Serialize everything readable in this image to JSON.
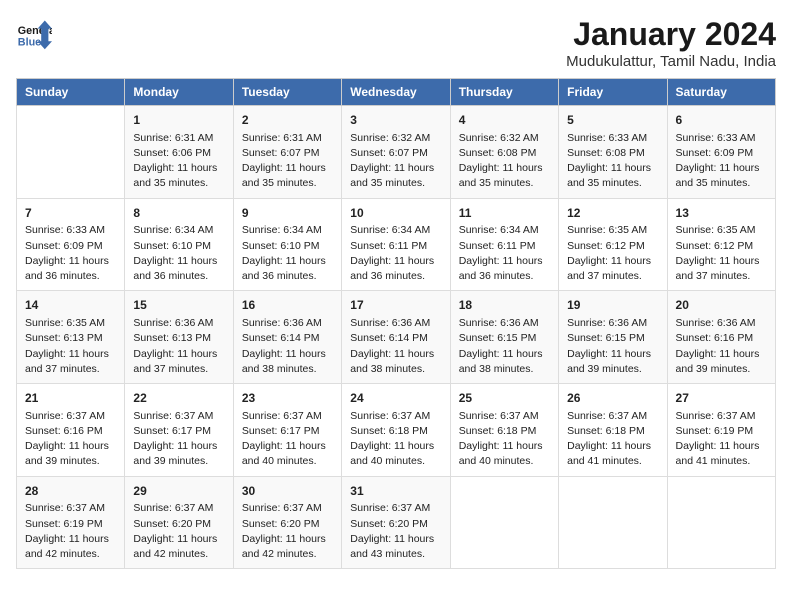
{
  "logo": {
    "line1": "General",
    "line2": "Blue"
  },
  "title": "January 2024",
  "subtitle": "Mudukulattur, Tamil Nadu, India",
  "days_of_week": [
    "Sunday",
    "Monday",
    "Tuesday",
    "Wednesday",
    "Thursday",
    "Friday",
    "Saturday"
  ],
  "weeks": [
    [
      {
        "num": "",
        "info": ""
      },
      {
        "num": "1",
        "info": "Sunrise: 6:31 AM\nSunset: 6:06 PM\nDaylight: 11 hours\nand 35 minutes."
      },
      {
        "num": "2",
        "info": "Sunrise: 6:31 AM\nSunset: 6:07 PM\nDaylight: 11 hours\nand 35 minutes."
      },
      {
        "num": "3",
        "info": "Sunrise: 6:32 AM\nSunset: 6:07 PM\nDaylight: 11 hours\nand 35 minutes."
      },
      {
        "num": "4",
        "info": "Sunrise: 6:32 AM\nSunset: 6:08 PM\nDaylight: 11 hours\nand 35 minutes."
      },
      {
        "num": "5",
        "info": "Sunrise: 6:33 AM\nSunset: 6:08 PM\nDaylight: 11 hours\nand 35 minutes."
      },
      {
        "num": "6",
        "info": "Sunrise: 6:33 AM\nSunset: 6:09 PM\nDaylight: 11 hours\nand 35 minutes."
      }
    ],
    [
      {
        "num": "7",
        "info": "Sunrise: 6:33 AM\nSunset: 6:09 PM\nDaylight: 11 hours\nand 36 minutes."
      },
      {
        "num": "8",
        "info": "Sunrise: 6:34 AM\nSunset: 6:10 PM\nDaylight: 11 hours\nand 36 minutes."
      },
      {
        "num": "9",
        "info": "Sunrise: 6:34 AM\nSunset: 6:10 PM\nDaylight: 11 hours\nand 36 minutes."
      },
      {
        "num": "10",
        "info": "Sunrise: 6:34 AM\nSunset: 6:11 PM\nDaylight: 11 hours\nand 36 minutes."
      },
      {
        "num": "11",
        "info": "Sunrise: 6:34 AM\nSunset: 6:11 PM\nDaylight: 11 hours\nand 36 minutes."
      },
      {
        "num": "12",
        "info": "Sunrise: 6:35 AM\nSunset: 6:12 PM\nDaylight: 11 hours\nand 37 minutes."
      },
      {
        "num": "13",
        "info": "Sunrise: 6:35 AM\nSunset: 6:12 PM\nDaylight: 11 hours\nand 37 minutes."
      }
    ],
    [
      {
        "num": "14",
        "info": "Sunrise: 6:35 AM\nSunset: 6:13 PM\nDaylight: 11 hours\nand 37 minutes."
      },
      {
        "num": "15",
        "info": "Sunrise: 6:36 AM\nSunset: 6:13 PM\nDaylight: 11 hours\nand 37 minutes."
      },
      {
        "num": "16",
        "info": "Sunrise: 6:36 AM\nSunset: 6:14 PM\nDaylight: 11 hours\nand 38 minutes."
      },
      {
        "num": "17",
        "info": "Sunrise: 6:36 AM\nSunset: 6:14 PM\nDaylight: 11 hours\nand 38 minutes."
      },
      {
        "num": "18",
        "info": "Sunrise: 6:36 AM\nSunset: 6:15 PM\nDaylight: 11 hours\nand 38 minutes."
      },
      {
        "num": "19",
        "info": "Sunrise: 6:36 AM\nSunset: 6:15 PM\nDaylight: 11 hours\nand 39 minutes."
      },
      {
        "num": "20",
        "info": "Sunrise: 6:36 AM\nSunset: 6:16 PM\nDaylight: 11 hours\nand 39 minutes."
      }
    ],
    [
      {
        "num": "21",
        "info": "Sunrise: 6:37 AM\nSunset: 6:16 PM\nDaylight: 11 hours\nand 39 minutes."
      },
      {
        "num": "22",
        "info": "Sunrise: 6:37 AM\nSunset: 6:17 PM\nDaylight: 11 hours\nand 39 minutes."
      },
      {
        "num": "23",
        "info": "Sunrise: 6:37 AM\nSunset: 6:17 PM\nDaylight: 11 hours\nand 40 minutes."
      },
      {
        "num": "24",
        "info": "Sunrise: 6:37 AM\nSunset: 6:18 PM\nDaylight: 11 hours\nand 40 minutes."
      },
      {
        "num": "25",
        "info": "Sunrise: 6:37 AM\nSunset: 6:18 PM\nDaylight: 11 hours\nand 40 minutes."
      },
      {
        "num": "26",
        "info": "Sunrise: 6:37 AM\nSunset: 6:18 PM\nDaylight: 11 hours\nand 41 minutes."
      },
      {
        "num": "27",
        "info": "Sunrise: 6:37 AM\nSunset: 6:19 PM\nDaylight: 11 hours\nand 41 minutes."
      }
    ],
    [
      {
        "num": "28",
        "info": "Sunrise: 6:37 AM\nSunset: 6:19 PM\nDaylight: 11 hours\nand 42 minutes."
      },
      {
        "num": "29",
        "info": "Sunrise: 6:37 AM\nSunset: 6:20 PM\nDaylight: 11 hours\nand 42 minutes."
      },
      {
        "num": "30",
        "info": "Sunrise: 6:37 AM\nSunset: 6:20 PM\nDaylight: 11 hours\nand 42 minutes."
      },
      {
        "num": "31",
        "info": "Sunrise: 6:37 AM\nSunset: 6:20 PM\nDaylight: 11 hours\nand 43 minutes."
      },
      {
        "num": "",
        "info": ""
      },
      {
        "num": "",
        "info": ""
      },
      {
        "num": "",
        "info": ""
      }
    ]
  ]
}
